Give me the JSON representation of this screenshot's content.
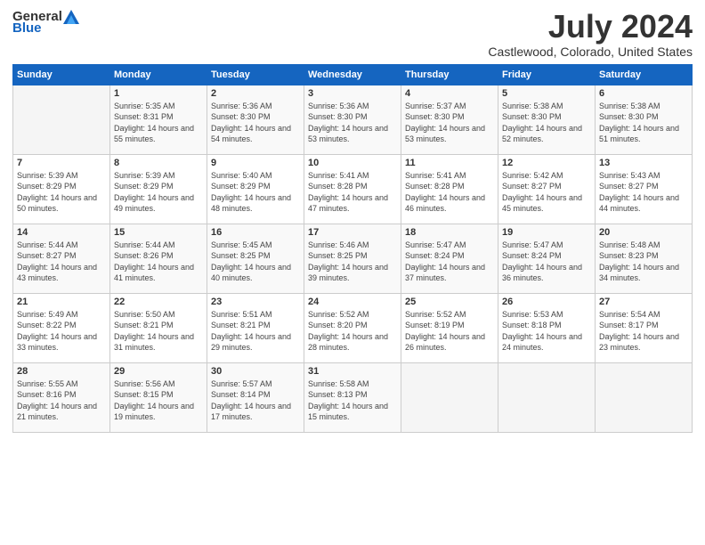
{
  "header": {
    "logo_general": "General",
    "logo_blue": "Blue",
    "month": "July 2024",
    "location": "Castlewood, Colorado, United States"
  },
  "weekdays": [
    "Sunday",
    "Monday",
    "Tuesday",
    "Wednesday",
    "Thursday",
    "Friday",
    "Saturday"
  ],
  "weeks": [
    [
      {
        "day": "",
        "sunrise": "",
        "sunset": "",
        "daylight": ""
      },
      {
        "day": "1",
        "sunrise": "Sunrise: 5:35 AM",
        "sunset": "Sunset: 8:31 PM",
        "daylight": "Daylight: 14 hours and 55 minutes."
      },
      {
        "day": "2",
        "sunrise": "Sunrise: 5:36 AM",
        "sunset": "Sunset: 8:30 PM",
        "daylight": "Daylight: 14 hours and 54 minutes."
      },
      {
        "day": "3",
        "sunrise": "Sunrise: 5:36 AM",
        "sunset": "Sunset: 8:30 PM",
        "daylight": "Daylight: 14 hours and 53 minutes."
      },
      {
        "day": "4",
        "sunrise": "Sunrise: 5:37 AM",
        "sunset": "Sunset: 8:30 PM",
        "daylight": "Daylight: 14 hours and 53 minutes."
      },
      {
        "day": "5",
        "sunrise": "Sunrise: 5:38 AM",
        "sunset": "Sunset: 8:30 PM",
        "daylight": "Daylight: 14 hours and 52 minutes."
      },
      {
        "day": "6",
        "sunrise": "Sunrise: 5:38 AM",
        "sunset": "Sunset: 8:30 PM",
        "daylight": "Daylight: 14 hours and 51 minutes."
      }
    ],
    [
      {
        "day": "7",
        "sunrise": "Sunrise: 5:39 AM",
        "sunset": "Sunset: 8:29 PM",
        "daylight": "Daylight: 14 hours and 50 minutes."
      },
      {
        "day": "8",
        "sunrise": "Sunrise: 5:39 AM",
        "sunset": "Sunset: 8:29 PM",
        "daylight": "Daylight: 14 hours and 49 minutes."
      },
      {
        "day": "9",
        "sunrise": "Sunrise: 5:40 AM",
        "sunset": "Sunset: 8:29 PM",
        "daylight": "Daylight: 14 hours and 48 minutes."
      },
      {
        "day": "10",
        "sunrise": "Sunrise: 5:41 AM",
        "sunset": "Sunset: 8:28 PM",
        "daylight": "Daylight: 14 hours and 47 minutes."
      },
      {
        "day": "11",
        "sunrise": "Sunrise: 5:41 AM",
        "sunset": "Sunset: 8:28 PM",
        "daylight": "Daylight: 14 hours and 46 minutes."
      },
      {
        "day": "12",
        "sunrise": "Sunrise: 5:42 AM",
        "sunset": "Sunset: 8:27 PM",
        "daylight": "Daylight: 14 hours and 45 minutes."
      },
      {
        "day": "13",
        "sunrise": "Sunrise: 5:43 AM",
        "sunset": "Sunset: 8:27 PM",
        "daylight": "Daylight: 14 hours and 44 minutes."
      }
    ],
    [
      {
        "day": "14",
        "sunrise": "Sunrise: 5:44 AM",
        "sunset": "Sunset: 8:27 PM",
        "daylight": "Daylight: 14 hours and 43 minutes."
      },
      {
        "day": "15",
        "sunrise": "Sunrise: 5:44 AM",
        "sunset": "Sunset: 8:26 PM",
        "daylight": "Daylight: 14 hours and 41 minutes."
      },
      {
        "day": "16",
        "sunrise": "Sunrise: 5:45 AM",
        "sunset": "Sunset: 8:25 PM",
        "daylight": "Daylight: 14 hours and 40 minutes."
      },
      {
        "day": "17",
        "sunrise": "Sunrise: 5:46 AM",
        "sunset": "Sunset: 8:25 PM",
        "daylight": "Daylight: 14 hours and 39 minutes."
      },
      {
        "day": "18",
        "sunrise": "Sunrise: 5:47 AM",
        "sunset": "Sunset: 8:24 PM",
        "daylight": "Daylight: 14 hours and 37 minutes."
      },
      {
        "day": "19",
        "sunrise": "Sunrise: 5:47 AM",
        "sunset": "Sunset: 8:24 PM",
        "daylight": "Daylight: 14 hours and 36 minutes."
      },
      {
        "day": "20",
        "sunrise": "Sunrise: 5:48 AM",
        "sunset": "Sunset: 8:23 PM",
        "daylight": "Daylight: 14 hours and 34 minutes."
      }
    ],
    [
      {
        "day": "21",
        "sunrise": "Sunrise: 5:49 AM",
        "sunset": "Sunset: 8:22 PM",
        "daylight": "Daylight: 14 hours and 33 minutes."
      },
      {
        "day": "22",
        "sunrise": "Sunrise: 5:50 AM",
        "sunset": "Sunset: 8:21 PM",
        "daylight": "Daylight: 14 hours and 31 minutes."
      },
      {
        "day": "23",
        "sunrise": "Sunrise: 5:51 AM",
        "sunset": "Sunset: 8:21 PM",
        "daylight": "Daylight: 14 hours and 29 minutes."
      },
      {
        "day": "24",
        "sunrise": "Sunrise: 5:52 AM",
        "sunset": "Sunset: 8:20 PM",
        "daylight": "Daylight: 14 hours and 28 minutes."
      },
      {
        "day": "25",
        "sunrise": "Sunrise: 5:52 AM",
        "sunset": "Sunset: 8:19 PM",
        "daylight": "Daylight: 14 hours and 26 minutes."
      },
      {
        "day": "26",
        "sunrise": "Sunrise: 5:53 AM",
        "sunset": "Sunset: 8:18 PM",
        "daylight": "Daylight: 14 hours and 24 minutes."
      },
      {
        "day": "27",
        "sunrise": "Sunrise: 5:54 AM",
        "sunset": "Sunset: 8:17 PM",
        "daylight": "Daylight: 14 hours and 23 minutes."
      }
    ],
    [
      {
        "day": "28",
        "sunrise": "Sunrise: 5:55 AM",
        "sunset": "Sunset: 8:16 PM",
        "daylight": "Daylight: 14 hours and 21 minutes."
      },
      {
        "day": "29",
        "sunrise": "Sunrise: 5:56 AM",
        "sunset": "Sunset: 8:15 PM",
        "daylight": "Daylight: 14 hours and 19 minutes."
      },
      {
        "day": "30",
        "sunrise": "Sunrise: 5:57 AM",
        "sunset": "Sunset: 8:14 PM",
        "daylight": "Daylight: 14 hours and 17 minutes."
      },
      {
        "day": "31",
        "sunrise": "Sunrise: 5:58 AM",
        "sunset": "Sunset: 8:13 PM",
        "daylight": "Daylight: 14 hours and 15 minutes."
      },
      {
        "day": "",
        "sunrise": "",
        "sunset": "",
        "daylight": ""
      },
      {
        "day": "",
        "sunrise": "",
        "sunset": "",
        "daylight": ""
      },
      {
        "day": "",
        "sunrise": "",
        "sunset": "",
        "daylight": ""
      }
    ]
  ]
}
